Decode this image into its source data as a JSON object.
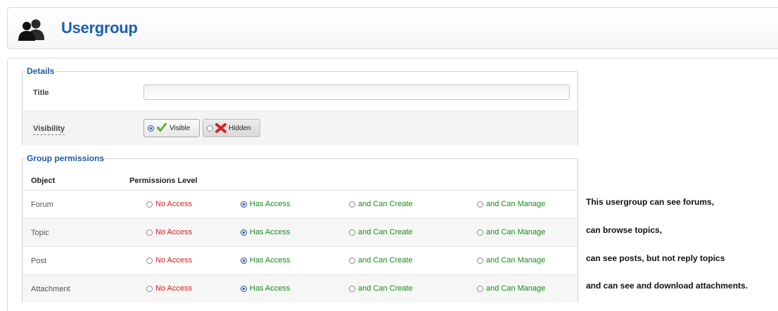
{
  "header": {
    "title": "Usergroup",
    "icon": "users-icon"
  },
  "details": {
    "legend": "Details",
    "title_label": "Title",
    "title_value": "",
    "visibility_label": "Visibility",
    "visible_label": "Visible",
    "hidden_label": "Hidden",
    "selected": "Visible"
  },
  "permissions": {
    "legend": "Group permissions",
    "col_object": "Object",
    "col_level": "Permissions Level",
    "options": [
      "No Access",
      "Has Access",
      "and Can Create",
      "and Can Manage"
    ],
    "rows": [
      {
        "object": "Forum",
        "selected": "Has Access"
      },
      {
        "object": "Topic",
        "selected": "Has Access"
      },
      {
        "object": "Post",
        "selected": "Has Access"
      },
      {
        "object": "Attachment",
        "selected": "Has Access"
      }
    ]
  },
  "notes": [
    "This usergroup can see forums,",
    "can browse topics,",
    "can see posts, but not reply topics",
    "and can see and download attachments."
  ],
  "colors": {
    "title_blue": "#1b5fb8",
    "no_access": "#e01b1b",
    "access_green": "#1b8a1b"
  }
}
